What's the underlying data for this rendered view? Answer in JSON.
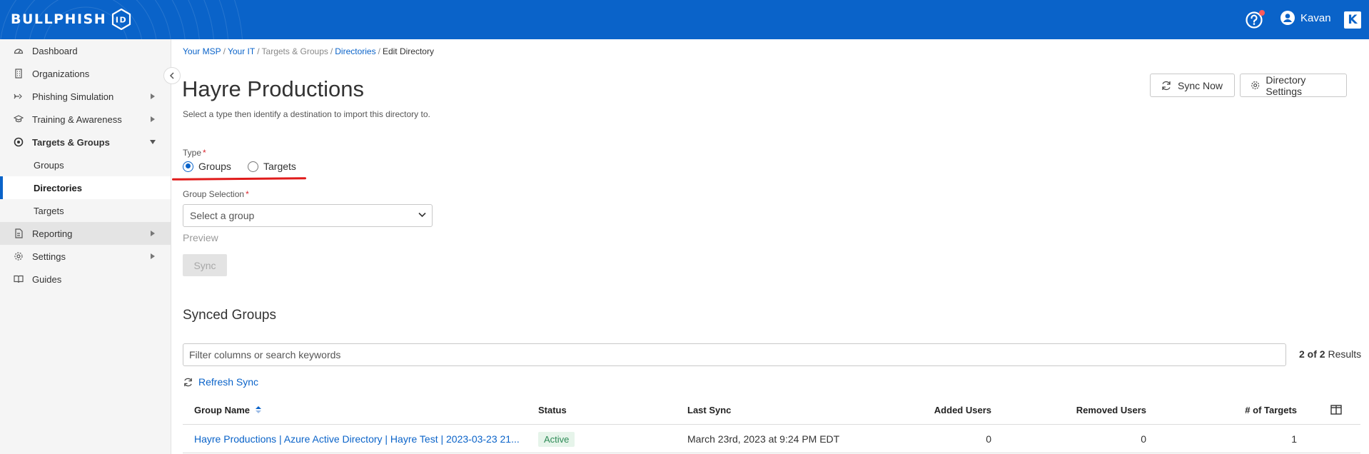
{
  "header": {
    "logo_text": "BULLPHISH",
    "logo_badge": "ID",
    "help_icon": "help-circle-icon",
    "user_name": "Kavan",
    "brand_mark": "K"
  },
  "sidebar": {
    "items": [
      {
        "label": "Dashboard",
        "icon": "speedometer-icon"
      },
      {
        "label": "Organizations",
        "icon": "building-icon"
      },
      {
        "label": "Phishing Simulation",
        "icon": "hook-icon"
      },
      {
        "label": "Training & Awareness",
        "icon": "graduation-cap-icon"
      },
      {
        "label": "Targets & Groups",
        "icon": "target-icon"
      },
      {
        "label": "Groups"
      },
      {
        "label": "Directories"
      },
      {
        "label": "Targets"
      },
      {
        "label": "Reporting",
        "icon": "document-icon"
      },
      {
        "label": "Settings",
        "icon": "gear-icon"
      },
      {
        "label": "Guides",
        "icon": "book-icon"
      }
    ]
  },
  "breadcrumb": {
    "items": [
      "Your MSP",
      "Your IT",
      "Targets & Groups",
      "Directories",
      "Edit Directory"
    ],
    "separator": "/"
  },
  "page": {
    "title": "Hayre Productions",
    "subtitle": "Select a type then identify a destination to import this directory to."
  },
  "actions": {
    "sync_now": "Sync Now",
    "directory_settings": "Directory Settings"
  },
  "form": {
    "type_label": "Type",
    "required_mark": "*",
    "type_options": [
      {
        "label": "Groups",
        "checked": true
      },
      {
        "label": "Targets",
        "checked": false
      }
    ],
    "group_selection_label": "Group Selection",
    "group_select_value": "Select a group",
    "preview_label": "Preview",
    "sync_label": "Sync"
  },
  "synced": {
    "title": "Synced Groups",
    "filter_placeholder": "Filter columns or search keywords",
    "results_count": "2 of 2",
    "results_label": "Results",
    "refresh_label": "Refresh Sync",
    "columns": [
      "Group Name",
      "Status",
      "Last Sync",
      "Added Users",
      "Removed Users",
      "# of Targets"
    ],
    "rows": [
      {
        "group_name": "Hayre Productions | Azure Active Directory | Hayre Test | 2023-03-23 21...",
        "status": "Active",
        "last_sync": "March 23rd, 2023 at 9:24 PM EDT",
        "added_users": "0",
        "removed_users": "0",
        "targets": "1"
      }
    ]
  },
  "colors": {
    "brand_blue": "#0a63c9",
    "required_red": "#d9262f",
    "annotation_red": "#e01b1b",
    "active_green": "#2e8b57"
  }
}
